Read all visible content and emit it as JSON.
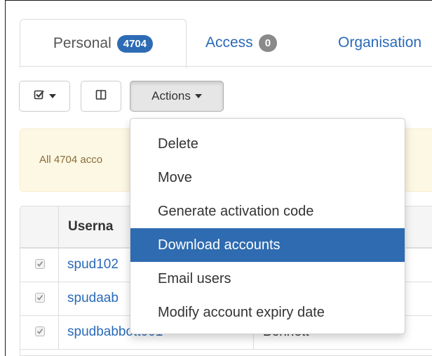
{
  "tabs": [
    {
      "label": "Personal",
      "badge": "4704",
      "badge_color": "#2e6bb5",
      "active": true
    },
    {
      "label": "Access",
      "badge": "0",
      "badge_color": "#8a8a8a",
      "active": false
    },
    {
      "label": "Organisation",
      "active": false
    }
  ],
  "toolbar": {
    "select_icon": "check-square-icon",
    "columns_icon": "columns-icon",
    "actions_label": "Actions"
  },
  "alert": {
    "text": "All 4704 acco"
  },
  "table": {
    "header_username": "Userna",
    "rows": [
      {
        "checked": true,
        "username": "spud102",
        "last_name": ""
      },
      {
        "checked": true,
        "username": "spudaab",
        "last_name": ""
      },
      {
        "checked": true,
        "username": "spudbabbott001",
        "last_name": "Bennett"
      }
    ]
  },
  "actions_menu": {
    "items": [
      {
        "label": "Delete",
        "active": false
      },
      {
        "label": "Move",
        "active": false
      },
      {
        "label": "Generate activation code",
        "active": false
      },
      {
        "label": "Download accounts",
        "active": true
      },
      {
        "label": "Email users",
        "active": false
      },
      {
        "label": "Modify account expiry date",
        "active": false
      }
    ]
  },
  "colors": {
    "link": "#2a6ab8",
    "menu_highlight": "#2e6bb0",
    "alert_bg": "#fcf8e3"
  }
}
